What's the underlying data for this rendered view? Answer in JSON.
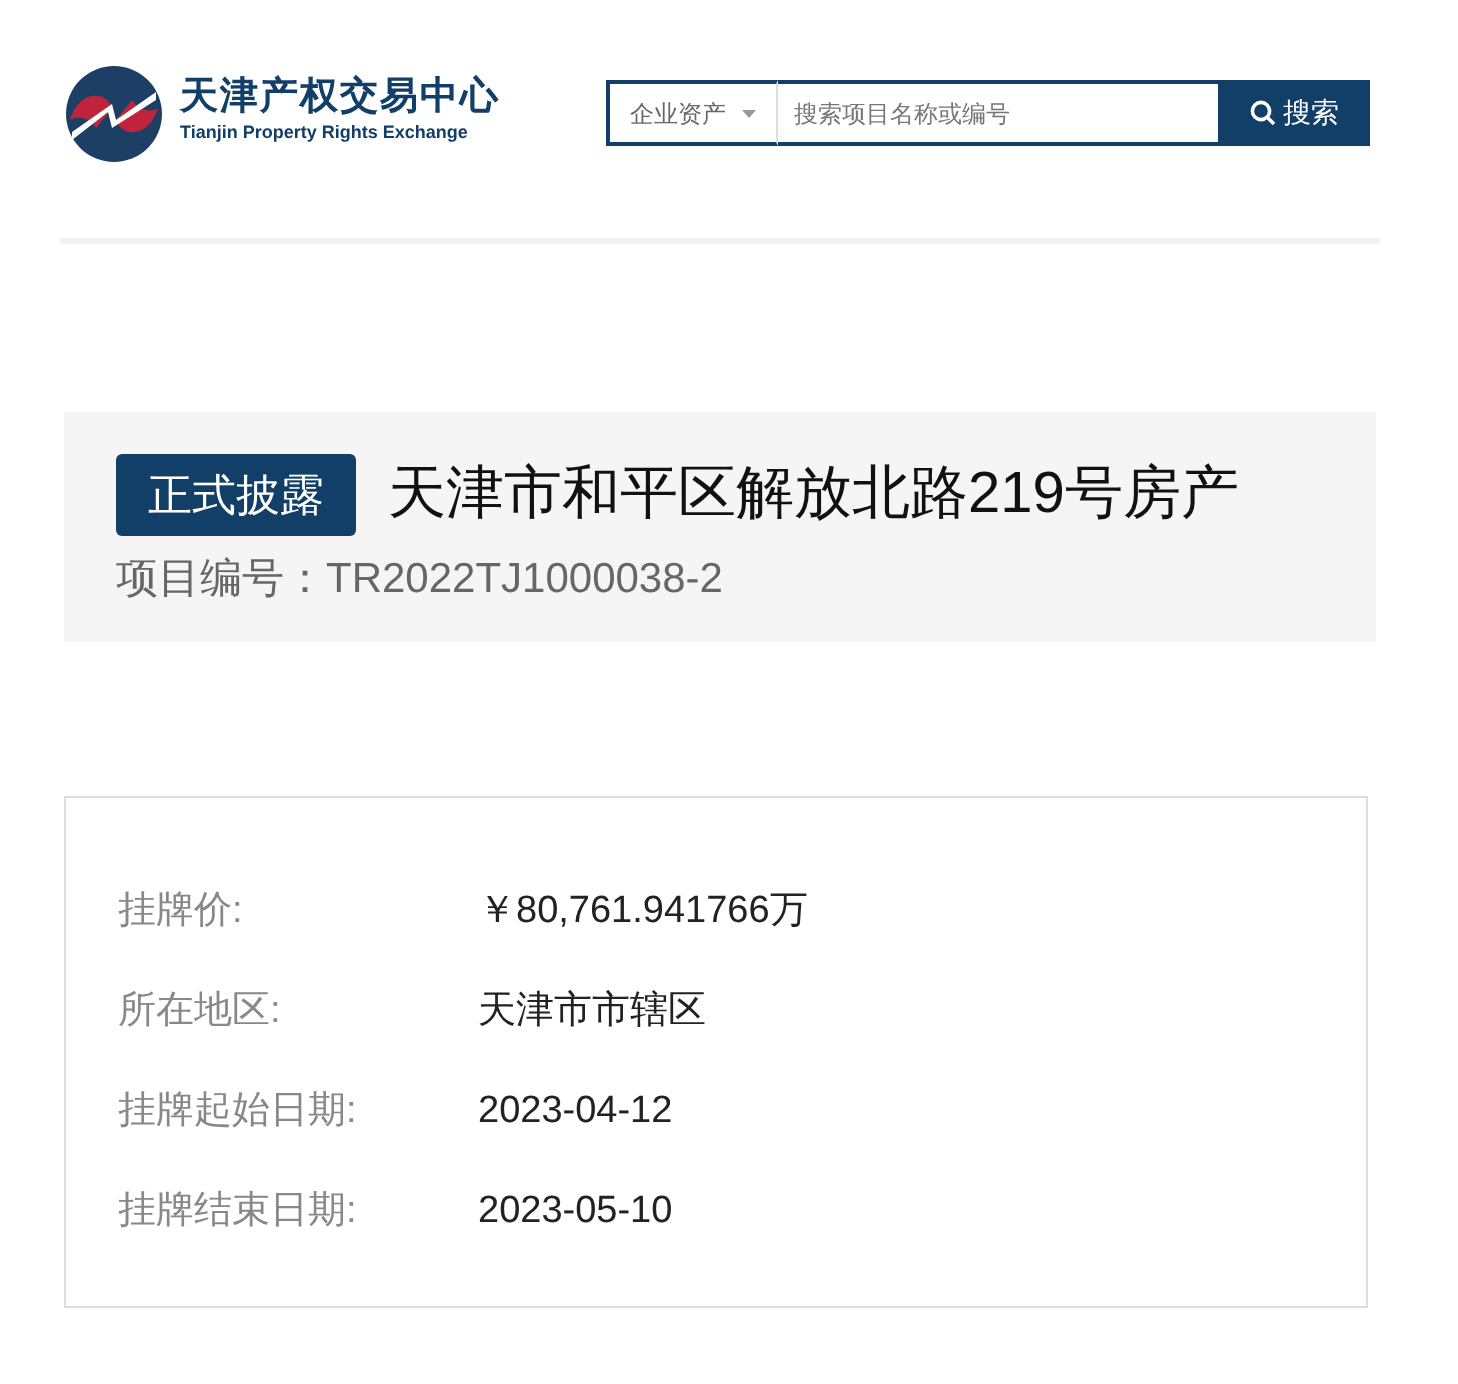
{
  "header": {
    "logo_title": "天津产权交易中心",
    "logo_subtitle": "Tianjin Property Rights Exchange",
    "search": {
      "category": "企业资产",
      "placeholder": "搜索项目名称或编号",
      "button": "搜索"
    }
  },
  "project": {
    "status": "正式披露",
    "title": "天津市和平区解放北路219号房产",
    "code_label": "项目编号：",
    "code": "TR2022TJ1000038-2"
  },
  "details": [
    {
      "label": "挂牌价:",
      "value": "￥80,761.941766万"
    },
    {
      "label": "所在地区:",
      "value": "天津市市辖区"
    },
    {
      "label": "挂牌起始日期:",
      "value": "2023-04-12"
    },
    {
      "label": "挂牌结束日期:",
      "value": "2023-05-10"
    }
  ]
}
